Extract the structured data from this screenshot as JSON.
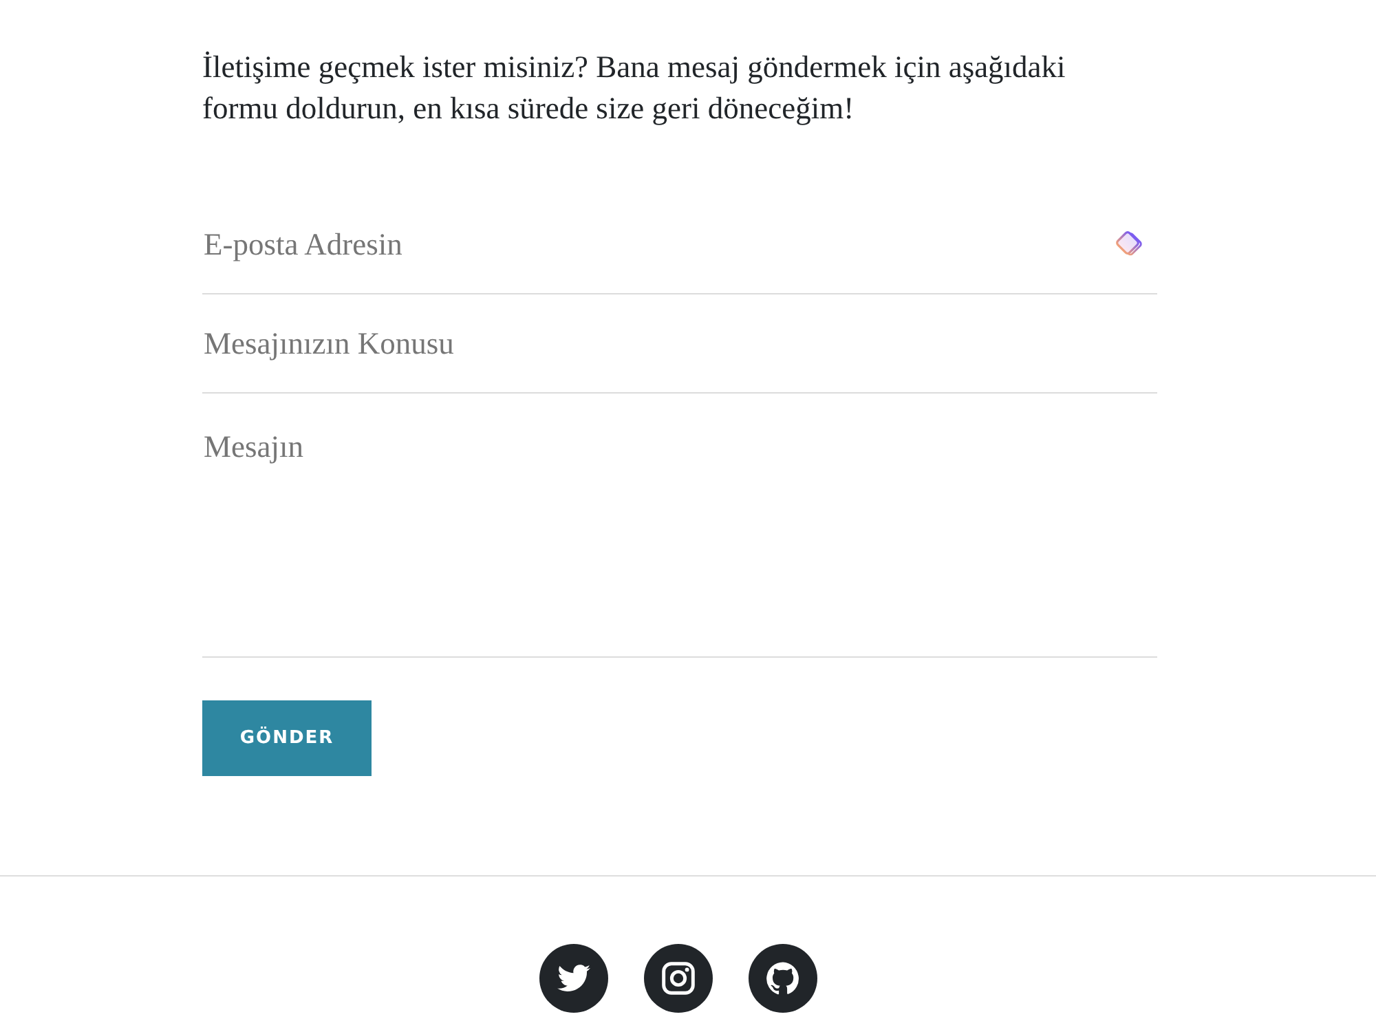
{
  "intro": {
    "text": "İletişime geçmek ister misiniz? Bana mesaj göndermek için aşağıdaki formu doldurun, en kısa sürede size geri döneceğim!"
  },
  "form": {
    "fields": [
      {
        "kind": "input",
        "placeholder": "E-posta Adresin",
        "extension_icon": true
      },
      {
        "kind": "input",
        "placeholder": "Mesajınızın Konusu",
        "extension_icon": false
      },
      {
        "kind": "textarea",
        "placeholder": "Mesajın",
        "extension_icon": false
      }
    ],
    "submit_button": {
      "label": "GÖNDER"
    }
  },
  "footer": {
    "social_links": [
      {
        "kind": "bird"
      },
      {
        "kind": "camera"
      },
      {
        "kind": "cat"
      }
    ]
  }
}
